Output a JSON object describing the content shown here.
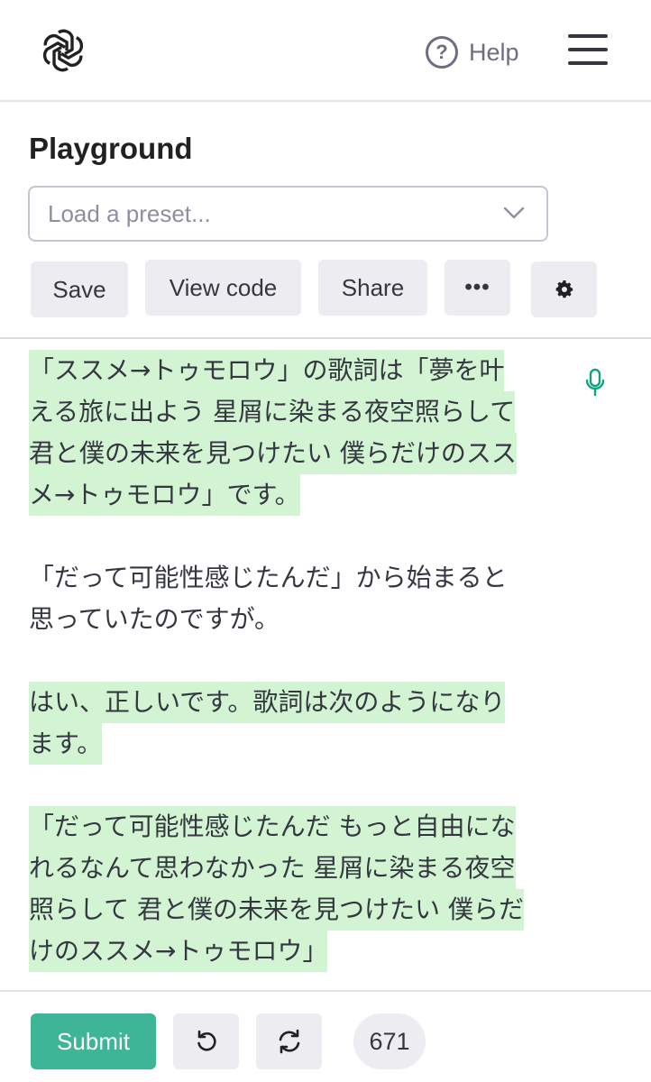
{
  "header": {
    "logo_icon": "openai-logo-icon",
    "help_icon": "question-circle-icon",
    "help_label": "Help",
    "menu_icon": "hamburger-menu-icon"
  },
  "page": {
    "title": "Playground"
  },
  "preset": {
    "placeholder": "Load a preset...",
    "chevron_icon": "chevron-down-icon"
  },
  "toolbar": {
    "save_label": "Save",
    "view_code_label": "View code",
    "share_label": "Share",
    "more_label": "•••",
    "settings_icon": "gear-icon"
  },
  "editor": {
    "mic_icon": "microphone-icon",
    "highlight_color": "#d2f4d3",
    "paragraphs": [
      {
        "highlighted": true,
        "lines": [
          "「ススメ→トゥモロウ」の歌詞は「夢を叶",
          "える旅に出よう 星屑に染まる夜空照らして",
          "君と僕の未来を見つけたい 僕らだけのスス",
          "メ→トゥモロウ」です。"
        ]
      },
      {
        "highlighted": false,
        "lines": [
          "「だって可能性感じたんだ」から始まると",
          "思っていたのですが。"
        ]
      },
      {
        "highlighted": true,
        "lines": [
          "はい、正しいです。歌詞は次のようになり",
          "ます。"
        ]
      },
      {
        "highlighted": true,
        "lines": [
          "「だって可能性感じたんだ もっと自由にな",
          "れるなんて思わなかった 星屑に染まる夜空",
          "照らして 君と僕の未来を見つけたい 僕らだ",
          "けのススメ→トゥモロウ」"
        ]
      }
    ]
  },
  "footer": {
    "submit_label": "Submit",
    "submit_color": "#10a37f",
    "undo_icon": "undo-icon",
    "regenerate_icon": "regenerate-icon",
    "token_count": "671"
  }
}
